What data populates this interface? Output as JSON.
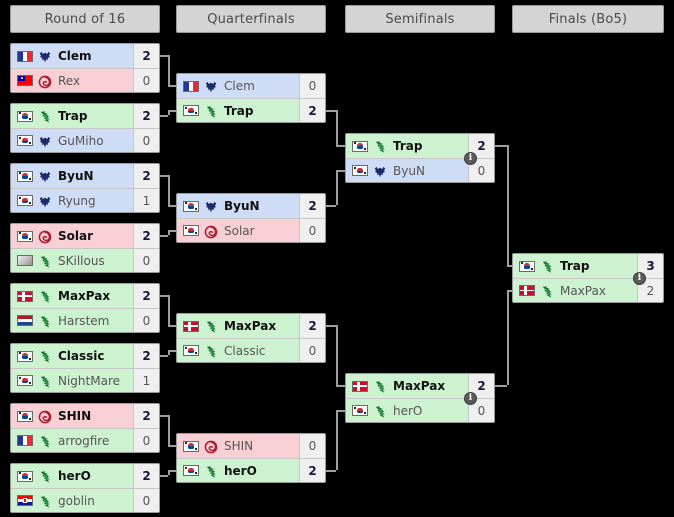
{
  "tournament": {
    "rounds": [
      {
        "id": "ro16",
        "label": "Round of 16"
      },
      {
        "id": "qf",
        "label": "Quarterfinals"
      },
      {
        "id": "sf",
        "label": "Semifinals"
      },
      {
        "id": "finals",
        "label": "Finals (Bo5)"
      }
    ]
  },
  "colors": {
    "terran": "#cfdcf5",
    "zerg": "#f8cfd4",
    "protoss": "#ccf2cf",
    "header_bg": "#d4d4d4",
    "line": "#9e9e9e",
    "background": "#000000"
  },
  "icons": {
    "info": "info-icon",
    "terran": "terran-race-icon",
    "zerg": "zerg-race-icon",
    "protoss": "protoss-race-icon"
  },
  "ro16": [
    {
      "id": "ro16-m1",
      "players": [
        {
          "name": "Clem",
          "score": "2",
          "race": "terran",
          "flag": "fr",
          "winner": true
        },
        {
          "name": "Rex",
          "score": "0",
          "race": "zerg",
          "flag": "tw",
          "winner": false
        }
      ]
    },
    {
      "id": "ro16-m2",
      "players": [
        {
          "name": "Trap",
          "score": "2",
          "race": "protoss",
          "flag": "kr",
          "winner": true
        },
        {
          "name": "GuMiho",
          "score": "0",
          "race": "terran",
          "flag": "kr",
          "winner": false
        }
      ]
    },
    {
      "id": "ro16-m3",
      "players": [
        {
          "name": "ByuN",
          "score": "2",
          "race": "terran",
          "flag": "kr",
          "winner": true
        },
        {
          "name": "Ryung",
          "score": "1",
          "race": "terran",
          "flag": "kr",
          "winner": false
        }
      ]
    },
    {
      "id": "ro16-m4",
      "players": [
        {
          "name": "Solar",
          "score": "2",
          "race": "zerg",
          "flag": "kr",
          "winner": true
        },
        {
          "name": "SKillous",
          "score": "0",
          "race": "protoss",
          "flag": "none",
          "winner": false
        }
      ]
    },
    {
      "id": "ro16-m5",
      "players": [
        {
          "name": "MaxPax",
          "score": "2",
          "race": "protoss",
          "flag": "dk",
          "winner": true
        },
        {
          "name": "Harstem",
          "score": "0",
          "race": "protoss",
          "flag": "nl",
          "winner": false
        }
      ]
    },
    {
      "id": "ro16-m6",
      "players": [
        {
          "name": "Classic",
          "score": "2",
          "race": "protoss",
          "flag": "kr",
          "winner": true
        },
        {
          "name": "NightMare",
          "score": "1",
          "race": "protoss",
          "flag": "kr",
          "winner": false
        }
      ]
    },
    {
      "id": "ro16-m7",
      "players": [
        {
          "name": "SHIN",
          "score": "2",
          "race": "zerg",
          "flag": "kr",
          "winner": true
        },
        {
          "name": "arrogfire",
          "score": "0",
          "race": "protoss",
          "flag": "fr",
          "winner": false
        }
      ]
    },
    {
      "id": "ro16-m8",
      "players": [
        {
          "name": "herO",
          "score": "2",
          "race": "protoss",
          "flag": "kr",
          "winner": true
        },
        {
          "name": "goblin",
          "score": "0",
          "race": "protoss",
          "flag": "hr",
          "winner": false
        }
      ]
    }
  ],
  "qf": [
    {
      "id": "qf-m1",
      "players": [
        {
          "name": "Clem",
          "score": "0",
          "race": "terran",
          "flag": "fr",
          "winner": false
        },
        {
          "name": "Trap",
          "score": "2",
          "race": "protoss",
          "flag": "kr",
          "winner": true
        }
      ]
    },
    {
      "id": "qf-m2",
      "players": [
        {
          "name": "ByuN",
          "score": "2",
          "race": "terran",
          "flag": "kr",
          "winner": true
        },
        {
          "name": "Solar",
          "score": "0",
          "race": "zerg",
          "flag": "kr",
          "winner": false
        }
      ]
    },
    {
      "id": "qf-m3",
      "players": [
        {
          "name": "MaxPax",
          "score": "2",
          "race": "protoss",
          "flag": "dk",
          "winner": true
        },
        {
          "name": "Classic",
          "score": "0",
          "race": "protoss",
          "flag": "kr",
          "winner": false
        }
      ]
    },
    {
      "id": "qf-m4",
      "players": [
        {
          "name": "SHIN",
          "score": "0",
          "race": "zerg",
          "flag": "kr",
          "winner": false
        },
        {
          "name": "herO",
          "score": "2",
          "race": "protoss",
          "flag": "kr",
          "winner": true
        }
      ]
    }
  ],
  "sf": [
    {
      "id": "sf-m1",
      "has_info": true,
      "players": [
        {
          "name": "Trap",
          "score": "2",
          "race": "protoss",
          "flag": "kr",
          "winner": true
        },
        {
          "name": "ByuN",
          "score": "0",
          "race": "terran",
          "flag": "kr",
          "winner": false
        }
      ]
    },
    {
      "id": "sf-m2",
      "has_info": true,
      "players": [
        {
          "name": "MaxPax",
          "score": "2",
          "race": "protoss",
          "flag": "dk",
          "winner": true
        },
        {
          "name": "herO",
          "score": "0",
          "race": "protoss",
          "flag": "kr",
          "winner": false
        }
      ]
    }
  ],
  "finals": [
    {
      "id": "final-m1",
      "has_info": true,
      "players": [
        {
          "name": "Trap",
          "score": "3",
          "race": "protoss",
          "flag": "kr",
          "winner": true
        },
        {
          "name": "MaxPax",
          "score": "2",
          "race": "protoss",
          "flag": "dk",
          "winner": false
        }
      ]
    }
  ]
}
